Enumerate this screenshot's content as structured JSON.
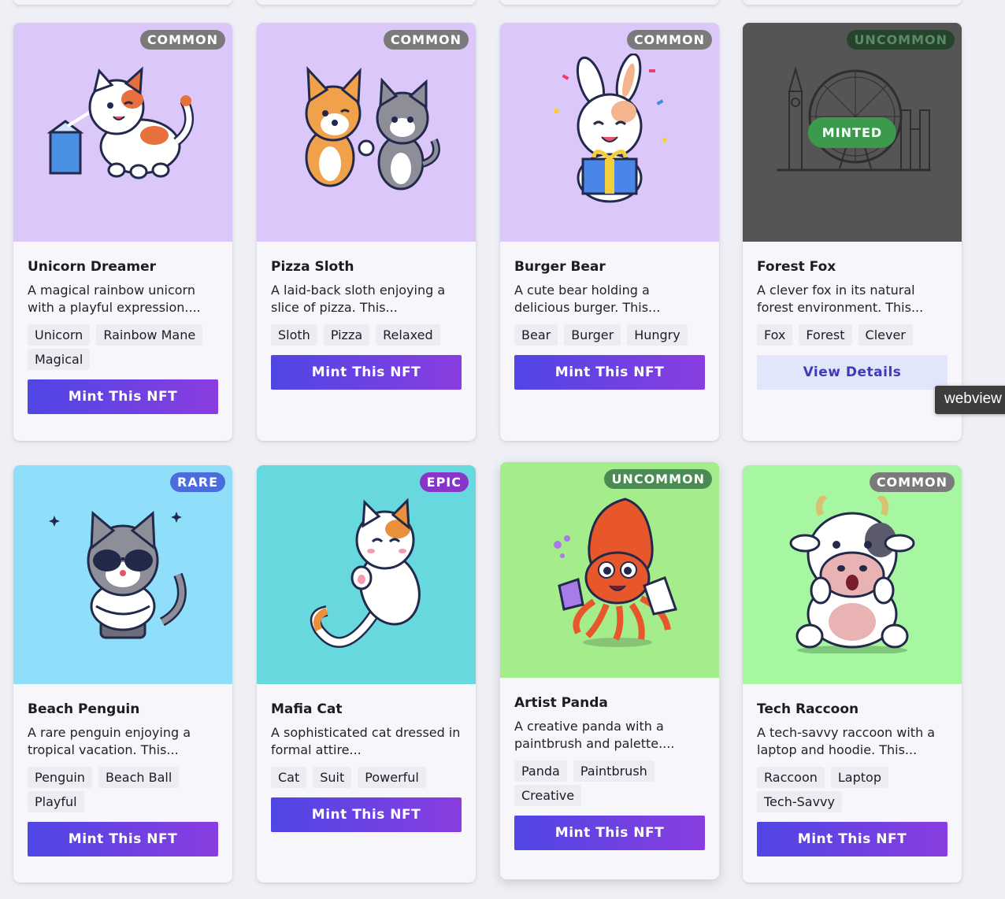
{
  "tooltip": "webview",
  "cards": [
    {
      "title": "Unicorn Dreamer",
      "description": "A magical rainbow unicorn with a playful expression....",
      "tags": [
        "Unicorn",
        "Rainbow Mane",
        "Magical"
      ],
      "rarity": "COMMON",
      "button": "Mint This NFT",
      "art_bg": "#dcc7fb",
      "badge_color": "#7a7a7a",
      "art": "cat-with-milk"
    },
    {
      "title": "Pizza Sloth",
      "description": "A laid-back sloth enjoying a slice of pizza. This...",
      "tags": [
        "Sloth",
        "Pizza",
        "Relaxed"
      ],
      "rarity": "COMMON",
      "button": "Mint This NFT",
      "art_bg": "#dcc7fb",
      "badge_color": "#7a7a7a",
      "art": "dog-and-cat-fist-bump"
    },
    {
      "title": "Burger Bear",
      "description": "A cute bear holding a delicious burger. This...",
      "tags": [
        "Bear",
        "Burger",
        "Hungry"
      ],
      "rarity": "COMMON",
      "button": "Mint This NFT",
      "art_bg": "#dcc7fb",
      "badge_color": "#7a7a7a",
      "art": "bunny-with-gift"
    },
    {
      "title": "Forest Fox",
      "description": "A clever fox in its natural forest environment. This...",
      "tags": [
        "Fox",
        "Forest",
        "Clever"
      ],
      "rarity": "UNCOMMON",
      "button": "View Details",
      "minted_label": "MINTED",
      "art_bg": "#5f5f5f",
      "badge_color": "#24452c",
      "art": "london-skyline"
    },
    {
      "title": "Beach Penguin",
      "description": "A rare penguin enjoying a tropical vacation. This...",
      "tags": [
        "Penguin",
        "Beach Ball",
        "Playful"
      ],
      "rarity": "RARE",
      "button": "Mint This NFT",
      "art_bg": "#8fdffb",
      "badge_color": "#4a6cdc",
      "art": "cool-cat-sunglasses"
    },
    {
      "title": "Mafia Cat",
      "description": "A sophisticated cat dressed in formal attire...",
      "tags": [
        "Cat",
        "Suit",
        "Powerful"
      ],
      "rarity": "EPIC",
      "button": "Mint This NFT",
      "art_bg": "#67d8de",
      "badge_color": "#8a35c9",
      "art": "floating-cat"
    },
    {
      "title": "Artist Panda",
      "description": "A creative panda with a paintbrush and palette....",
      "tags": [
        "Panda",
        "Paintbrush",
        "Creative"
      ],
      "rarity": "UNCOMMON",
      "button": "Mint This NFT",
      "art_bg": "#a5ec8a",
      "badge_color": "#4a8a53",
      "art": "squid-scientist"
    },
    {
      "title": "Tech Raccoon",
      "description": "A tech-savvy raccoon with a laptop and hoodie. This...",
      "tags": [
        "Raccoon",
        "Laptop",
        "Tech-Savvy"
      ],
      "rarity": "COMMON",
      "button": "Mint This NFT",
      "art_bg": "#a6f6a2",
      "badge_color": "#7a7a7a",
      "art": "surprised-cow"
    }
  ]
}
